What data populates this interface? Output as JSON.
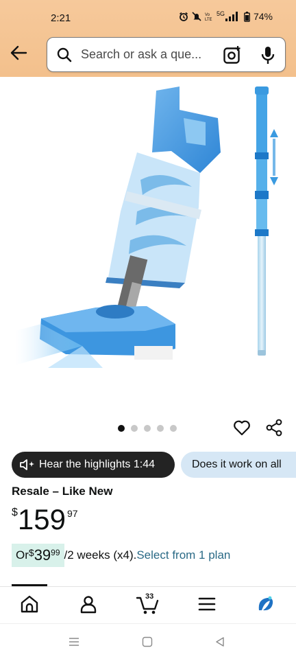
{
  "status_bar": {
    "time": "2:21",
    "battery": "74%",
    "network": "5G"
  },
  "search": {
    "placeholder": "Search or ask a que..."
  },
  "gallery": {
    "image_count": 5,
    "active_index": 0,
    "image_description": "blue handheld pool vacuum with telescopic pole"
  },
  "chips": {
    "highlights": "Hear the highlights 1:44",
    "question": "Does it work on all"
  },
  "product": {
    "condition": "Resale – Like New",
    "price_symbol": "$",
    "price_whole": "159",
    "price_fraction": "97"
  },
  "plan": {
    "prefix": "Or ",
    "symbol": "$",
    "whole": "39",
    "fraction": "99",
    "suffix": "/2 weeks (x4).",
    "link": "Select from 1 plan"
  },
  "bottom_nav": {
    "cart_count": "33",
    "items": [
      "home-icon",
      "account-icon",
      "cart-icon",
      "menu-icon",
      "assistant-icon"
    ]
  },
  "colors": {
    "header": "#f3c08c",
    "link": "#2a6a86",
    "chip_dark": "#232323",
    "chip_light": "#d6e7f5",
    "plan_highlight": "#d8f1ea",
    "assistant": "#1f72c4"
  }
}
